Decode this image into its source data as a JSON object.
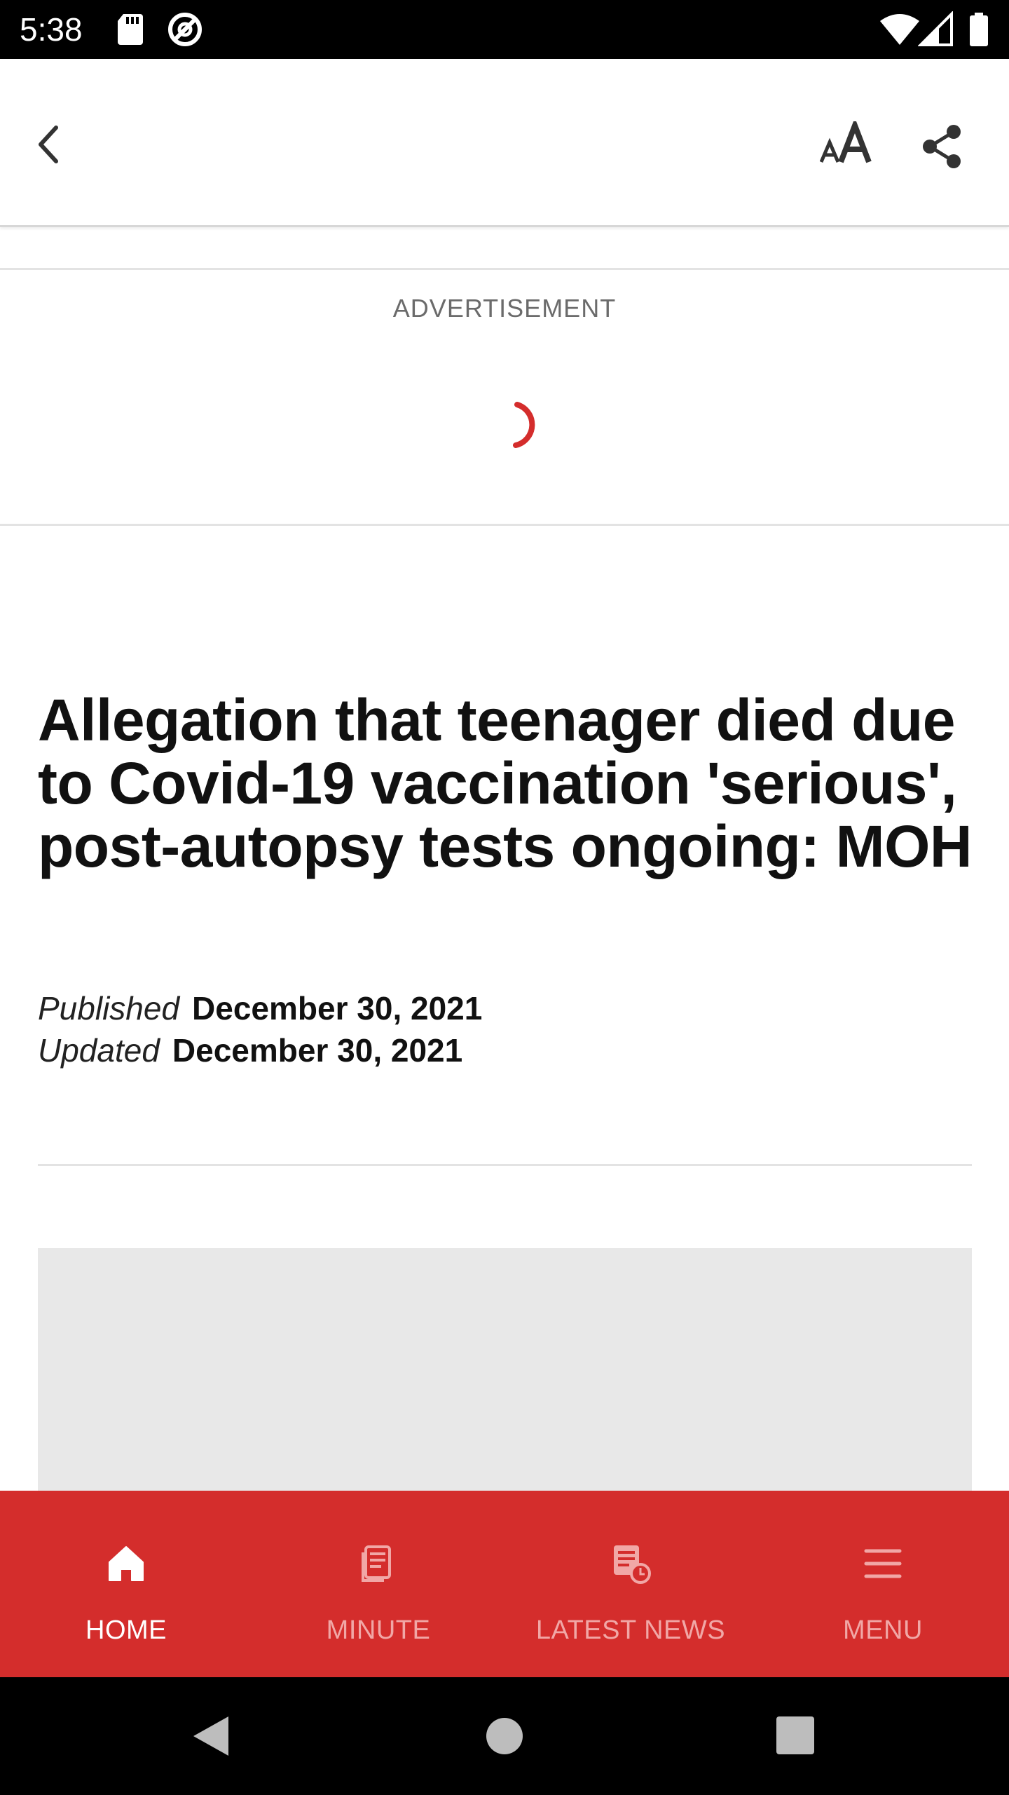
{
  "status_bar": {
    "time": "5:38",
    "icons": [
      "sd-card-icon",
      "at-sign-icon",
      "wifi-icon",
      "cell-signal-icon",
      "battery-icon"
    ]
  },
  "toolbar": {
    "icons": [
      "back-arrow-icon",
      "text-size-icon",
      "share-icon"
    ]
  },
  "advertisement": {
    "label": "ADVERTISEMENT",
    "spinner_color": "#d42d2c"
  },
  "article": {
    "headline": "Allegation that teenager died due to Covid-19 vaccination 'serious', post-autopsy tests ongoing: MOH",
    "published_label": "Published",
    "published_date": "December 30, 2021",
    "updated_label": "Updated",
    "updated_date": "December 30, 2021"
  },
  "bottom_nav": {
    "background": "#d42d2c",
    "items": [
      {
        "label": "HOME",
        "icon": "home-icon",
        "active": true
      },
      {
        "label": "MINUTE",
        "icon": "minute-icon",
        "active": false
      },
      {
        "label": "LATEST NEWS",
        "icon": "latest-news-icon",
        "active": false
      },
      {
        "label": "MENU",
        "icon": "menu-icon",
        "active": false
      }
    ]
  },
  "system_nav": {
    "icons": [
      "system-back-icon",
      "system-home-icon",
      "system-recents-icon"
    ]
  }
}
